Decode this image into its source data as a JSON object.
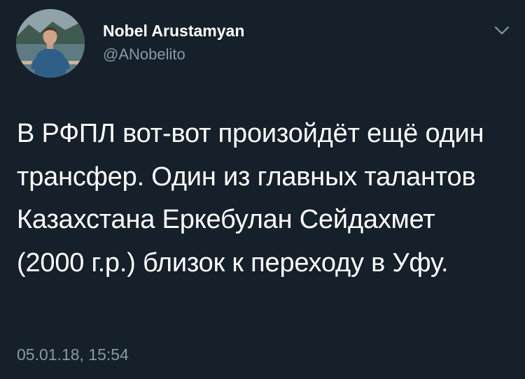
{
  "tweet": {
    "author": {
      "display_name": "Nobel Arustamyan",
      "handle": "@ANobelito",
      "avatar_icon": "profile-photo"
    },
    "text": "В РФПЛ вот-вот произойдёт ещё один трансфер. Один из главных талантов Казахстана Еркебулан Сейдахмет (2000 г.р.) близок к переходу в Уфу.",
    "timestamp": "05.01.18, 15:54",
    "menu_icon": "chevron-down-icon"
  },
  "colors": {
    "background": "#15202b",
    "text_primary": "#ffffff",
    "text_secondary": "#8899a6"
  }
}
